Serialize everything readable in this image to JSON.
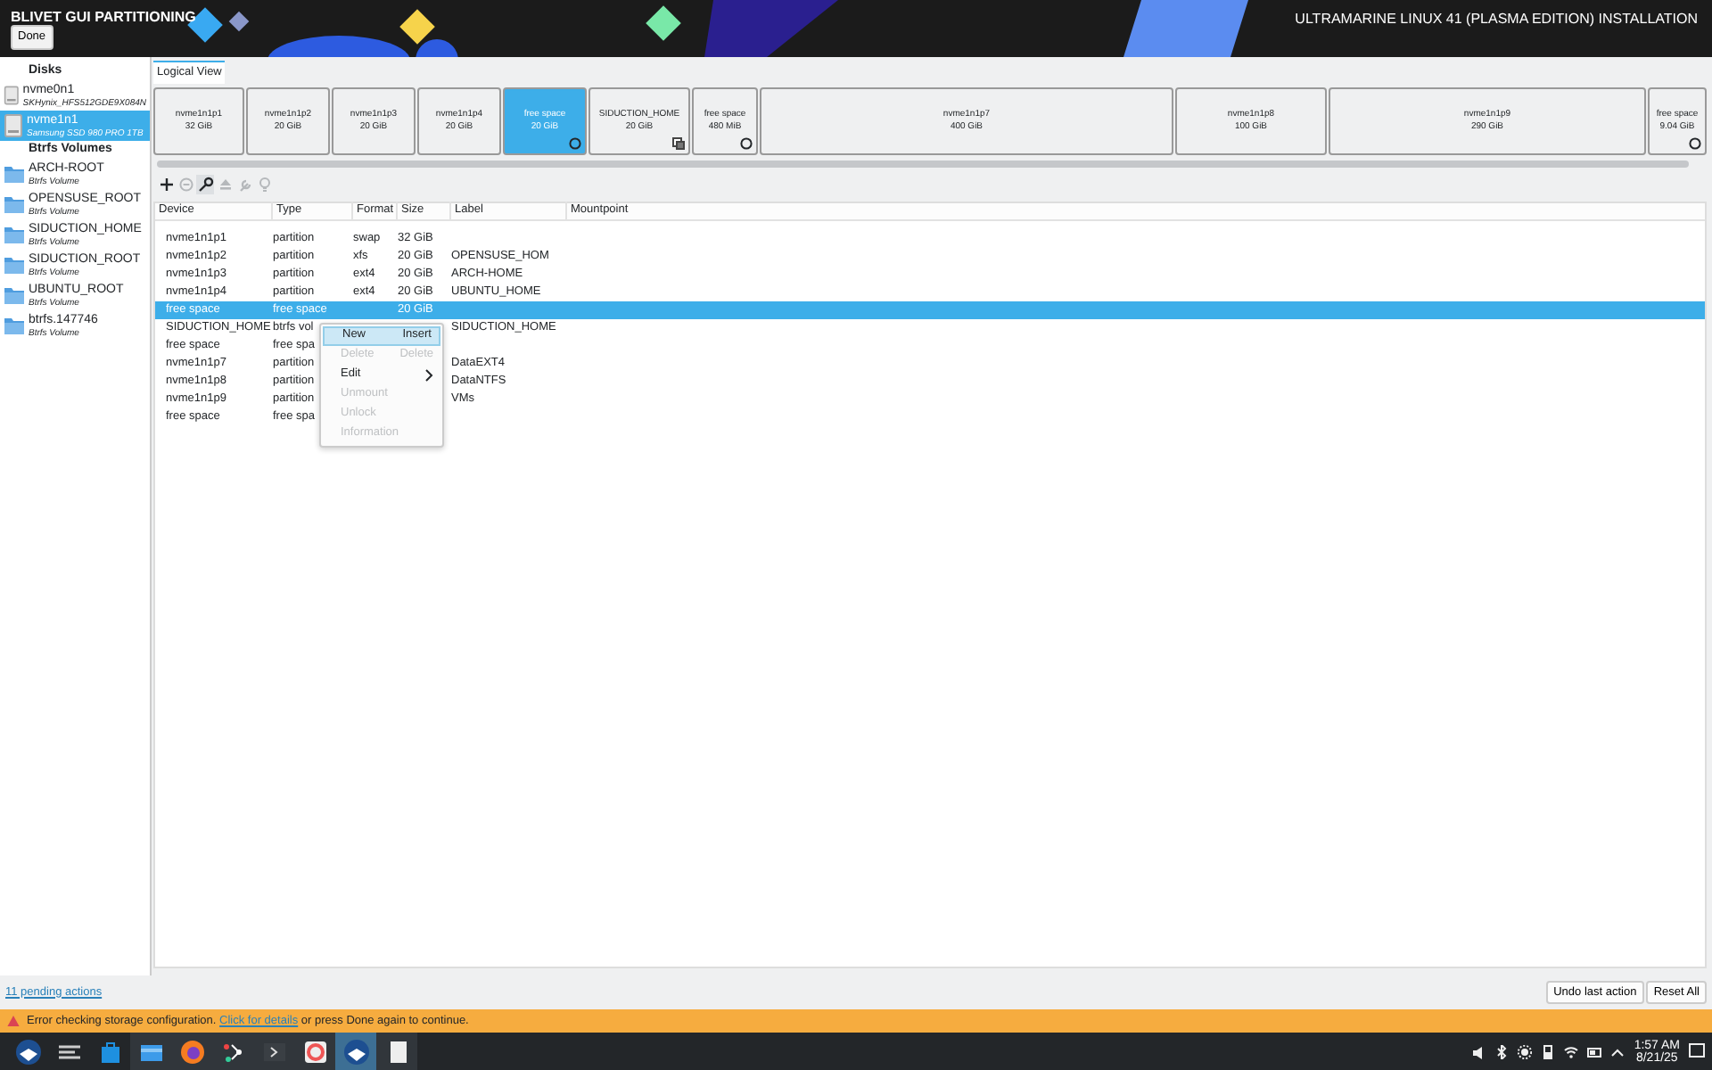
{
  "header": {
    "title": "BLIVET GUI PARTITIONING",
    "done_button": "Done",
    "installer_title": "ULTRAMARINE LINUX 41 (PLASMA EDITION) INSTALLATION"
  },
  "sidebar": {
    "sections": [
      {
        "heading": "Disks",
        "items": [
          {
            "kind": "disk",
            "name": "nvme0n1",
            "detail": "SKHynix_HFS512GDE9X084N",
            "selected": false
          },
          {
            "kind": "disk",
            "name": "nvme1n1",
            "detail": "Samsung SSD 980 PRO 1TB",
            "selected": true
          }
        ]
      },
      {
        "heading": "Btrfs Volumes",
        "items": [
          {
            "kind": "volume",
            "name": "ARCH-ROOT",
            "detail": "Btrfs Volume",
            "selected": false
          },
          {
            "kind": "volume",
            "name": "OPENSUSE_ROOT",
            "detail": "Btrfs Volume",
            "selected": false
          },
          {
            "kind": "volume",
            "name": "SIDUCTION_HOME",
            "detail": "Btrfs Volume",
            "selected": false
          },
          {
            "kind": "volume",
            "name": "SIDUCTION_ROOT",
            "detail": "Btrfs Volume",
            "selected": false
          },
          {
            "kind": "volume",
            "name": "UBUNTU_ROOT",
            "detail": "Btrfs Volume",
            "selected": false
          },
          {
            "kind": "volume",
            "name": "btrfs.147746",
            "detail": "Btrfs Volume",
            "selected": false
          }
        ]
      }
    ]
  },
  "view_tab": "Logical View",
  "blocks": [
    {
      "kind": "partition",
      "name": "nvme1n1p1",
      "size": "32 GiB",
      "selected": false
    },
    {
      "kind": "partition",
      "name": "nvme1n1p2",
      "size": "20 GiB",
      "selected": false
    },
    {
      "kind": "partition",
      "name": "nvme1n1p3",
      "size": "20 GiB",
      "selected": false
    },
    {
      "kind": "partition",
      "name": "nvme1n1p4",
      "size": "20 GiB",
      "selected": false
    },
    {
      "kind": "free",
      "name": "free space",
      "size": "20 GiB",
      "selected": true
    },
    {
      "kind": "btrfs",
      "name": "SIDUCTION_HOME",
      "size": "20 GiB",
      "selected": false
    },
    {
      "kind": "free",
      "name": "free space",
      "size": "480 MiB",
      "selected": false
    },
    {
      "kind": "partition",
      "name": "nvme1n1p7",
      "size": "400 GiB",
      "selected": false
    },
    {
      "kind": "partition",
      "name": "nvme1n1p8",
      "size": "100 GiB",
      "selected": false
    },
    {
      "kind": "partition",
      "name": "nvme1n1p9",
      "size": "290 GiB",
      "selected": false
    },
    {
      "kind": "free",
      "name": "free space",
      "size": "9.04 GiB",
      "selected": false
    }
  ],
  "toolbar": [
    {
      "kind": "add",
      "disabled": false
    },
    {
      "kind": "remove",
      "disabled": true
    },
    {
      "kind": "edit",
      "disabled": false
    },
    {
      "kind": "unmount",
      "disabled": true
    },
    {
      "kind": "decrypt",
      "disabled": true
    },
    {
      "kind": "info",
      "disabled": true
    }
  ],
  "table": {
    "columns": [
      "Device",
      "Type",
      "Format",
      "Size",
      "Label",
      "Mountpoint"
    ],
    "rows": [
      {
        "device": "nvme1n1p1",
        "type": "partition",
        "format": "swap",
        "size": "32 GiB",
        "label": "",
        "selected": false
      },
      {
        "device": "nvme1n1p2",
        "type": "partition",
        "format": "xfs",
        "size": "20 GiB",
        "label": "OPENSUSE_HOM",
        "selected": false
      },
      {
        "device": "nvme1n1p3",
        "type": "partition",
        "format": "ext4",
        "size": "20 GiB",
        "label": "ARCH-HOME",
        "selected": false
      },
      {
        "device": "nvme1n1p4",
        "type": "partition",
        "format": "ext4",
        "size": "20 GiB",
        "label": "UBUNTU_HOME",
        "selected": false
      },
      {
        "device": "free space",
        "type": "free space",
        "format": "",
        "size": "20 GiB",
        "label": "",
        "selected": true
      },
      {
        "device": "SIDUCTION_HOME",
        "type": "btrfs vol",
        "label": "SIDUCTION_HOME",
        "selected": false
      },
      {
        "device": "free space",
        "type": "free spa",
        "label": "",
        "selected": false
      },
      {
        "device": "nvme1n1p7",
        "type": "partition",
        "label": "DataEXT4",
        "selected": false
      },
      {
        "device": "nvme1n1p8",
        "type": "partition",
        "label": "DataNTFS",
        "selected": false
      },
      {
        "device": "nvme1n1p9",
        "type": "partition",
        "label": "VMs",
        "selected": false
      },
      {
        "device": "free space",
        "type": "free spa",
        "label": "",
        "selected": false
      }
    ]
  },
  "context_menu": [
    {
      "label": "New",
      "shortcut": "Insert",
      "disabled": false,
      "submenu": false,
      "selected": true
    },
    {
      "label": "Delete",
      "shortcut": "Delete",
      "disabled": true,
      "submenu": false,
      "selected": false
    },
    {
      "label": "Edit",
      "disabled": false,
      "submenu": true,
      "selected": false
    },
    {
      "label": "Unmount",
      "disabled": true,
      "submenu": false,
      "selected": false
    },
    {
      "label": "Unlock",
      "disabled": true,
      "submenu": false,
      "selected": false
    },
    {
      "label": "Information",
      "disabled": true,
      "submenu": false,
      "selected": false
    }
  ],
  "footer": {
    "pending_link": "11 pending actions",
    "buttons": [
      "Undo last action",
      "Reset All"
    ]
  },
  "error_bar": {
    "before": "Error checking storage configuration.",
    "link": "Click for details",
    "after": "or press Done again to continue."
  },
  "taskbar": {
    "apps": [
      {
        "selected": false
      },
      {
        "selected": false
      },
      {
        "selected": false
      },
      {
        "selected": false
      },
      {
        "selected": false
      },
      {
        "selected": false
      },
      {
        "selected": false
      },
      {
        "selected": false
      },
      {
        "selected": true
      },
      {
        "selected": false
      }
    ],
    "time": "1:57 AM",
    "date": "8/21/25"
  }
}
